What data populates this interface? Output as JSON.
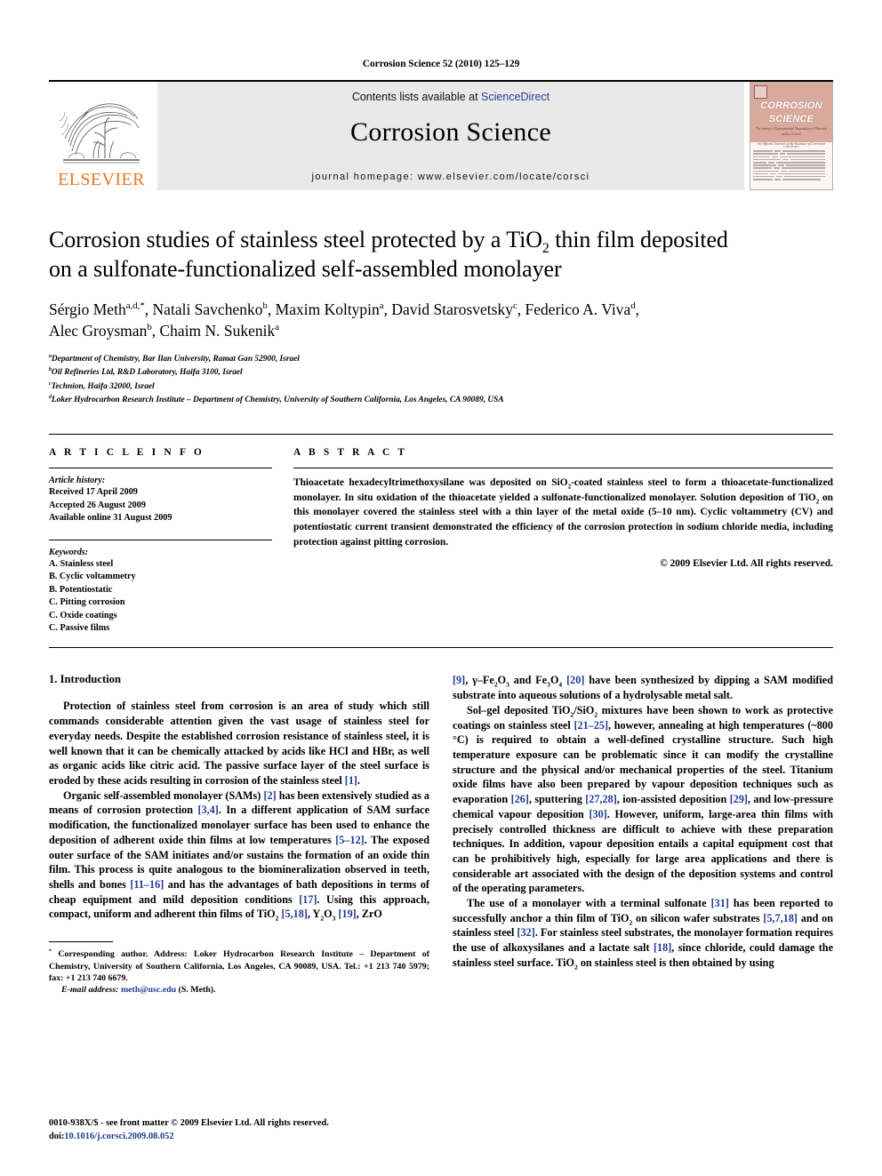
{
  "running_head": "Corrosion Science 52 (2010) 125–129",
  "masthead": {
    "publisher_name": "ELSEVIER",
    "publisher_logo_icon": "elsevier-tree-icon",
    "contents_prefix": "Contents lists available at ",
    "sciencedirect_label": "ScienceDirect",
    "journal_title": "Corrosion Science",
    "homepage_line": "journal homepage: www.elsevier.com/locate/corsci",
    "cover": {
      "title_line1": "CORROSION",
      "title_line2": "SCIENCE",
      "subtitle": "The Journal of Environmental Degradation of Materials and its Control",
      "society_line": "An Official Journal of the Institute of Corrosion",
      "contents_label": "CONTENTS"
    }
  },
  "article": {
    "title_line1_a": "Corrosion studies of stainless steel protected by a TiO",
    "title_line1_sub": "2",
    "title_line1_b": " thin film deposited",
    "title_line2": "on a sulfonate-functionalized self-assembled monolayer",
    "authors": [
      {
        "name": "Sérgio Meth",
        "marks": "a,d,*",
        "sep": ", "
      },
      {
        "name": "Natali Savchenko",
        "marks": "b",
        "sep": ", "
      },
      {
        "name": "Maxim Koltypin",
        "marks": "a",
        "sep": ", "
      },
      {
        "name": "David Starosvetsky",
        "marks": "c",
        "sep": ", "
      },
      {
        "name": "Federico A. Viva",
        "marks": "d",
        "sep": ", "
      },
      {
        "name": "Alec Groysman",
        "marks": "b",
        "sep": ", "
      },
      {
        "name": "Chaim N. Sukenik",
        "marks": "a",
        "sep": ""
      }
    ],
    "affiliations": [
      {
        "mark": "a",
        "text": "Department of Chemistry, Bar Ilan University, Ramat Gan 52900, Israel"
      },
      {
        "mark": "b",
        "text": "Oil Refineries Ltd, R&D Laboratory, Haifa 3100, Israel"
      },
      {
        "mark": "c",
        "text": "Technion, Haifa 32000, Israel"
      },
      {
        "mark": "d",
        "text": "Loker Hydrocarbon Research Institute – Department of Chemistry, University of Southern California, Los Angeles, CA 90089, USA"
      }
    ]
  },
  "article_info": {
    "heading": "A R T I C L E    I N F O",
    "history_label": "Article history:",
    "history": [
      "Received 17 April 2009",
      "Accepted 26 August 2009",
      "Available online 31 August 2009"
    ],
    "keywords_label": "Keywords:",
    "keywords": [
      "A. Stainless steel",
      "B. Cyclic voltammetry",
      "B. Potentiostatic",
      "C. Pitting corrosion",
      "C. Oxide coatings",
      "C. Passive films"
    ]
  },
  "abstract": {
    "heading": "A B S T R A C T",
    "part1": "Thioacetate hexadecyltrimethoxysilane was deposited on SiO",
    "sub1": "2",
    "part2": "-coated stainless steel to form a thioacetate-functionalized monolayer. In situ oxidation of the thioacetate yielded a sulfonate-functionalized monolayer. Solution deposition of TiO",
    "sub2": "2",
    "part3": " on this monolayer covered the stainless steel with a thin layer of the metal oxide (5–10 nm). Cyclic voltammetry (CV) and potentiostatic current transient demonstrated the efficiency of the corrosion protection in sodium chloride media, including protection against pitting corrosion.",
    "copyright": "© 2009 Elsevier Ltd. All rights reserved."
  },
  "body": {
    "section_title": "1. Introduction",
    "left_paragraphs": {
      "p1": "Protection of stainless steel from corrosion is an area of study which still commands considerable attention given the vast usage of stainless steel for everyday needs. Despite the established corrosion resistance of stainless steel, it is well known that it can be chemically attacked by acids like HCl and HBr, as well as organic acids like citric acid. The passive surface layer of the steel surface is eroded by these acids resulting in corrosion of the stainless steel ",
      "p1_ref": "[1]",
      "p1_end": ".",
      "p2_a": "Organic self-assembled monolayer (SAMs) ",
      "p2_r1": "[2]",
      "p2_b": " has been extensively studied as a means of corrosion protection ",
      "p2_r2": "[3,4]",
      "p2_c": ". In a different application of SAM surface modification, the functionalized monolayer surface has been used to enhance the deposition of adherent oxide thin films at low temperatures ",
      "p2_r3": "[5–12]",
      "p2_d": ". The exposed outer surface of the SAM initiates and/or sustains the formation of an oxide thin film. This process is quite analogous to the biomineralization observed in teeth, shells and bones ",
      "p2_r4": "[11–16]",
      "p2_e": " and has the advantages of bath depositions in terms of cheap equipment and mild deposition conditions ",
      "p2_r5": "[17]",
      "p2_f": ". Using this approach, compact, uniform and adherent thin films of TiO",
      "p2_sub1": "2",
      "p2_g": " ",
      "p2_r6": "[5,18]",
      "p2_h": ", Y",
      "p2_sub2": "2",
      "p2_i": "O",
      "p2_sub3": "3",
      "p2_j": " ",
      "p2_r7": "[19]",
      "p2_k": ", ZrO"
    },
    "right_paragraphs": {
      "p3_r1": "[9]",
      "p3_a": ", γ–Fe",
      "p3_s1": "2",
      "p3_b": "O",
      "p3_s2": "3",
      "p3_c": " and Fe",
      "p3_s3": "3",
      "p3_d": "O",
      "p3_s4": "4",
      "p3_e": " ",
      "p3_r2": "[20]",
      "p3_f": " have been synthesized by dipping a SAM modified substrate into aqueous solutions of a hydrolysable metal salt.",
      "p4_a": "Sol–gel deposited TiO",
      "p4_s1": "2",
      "p4_b": "/SiO",
      "p4_s2": "2",
      "p4_c": " mixtures have been shown to work as protective coatings on stainless steel ",
      "p4_r1": "[21–25]",
      "p4_d": ", however, annealing at high temperatures (~800 °C) is required to obtain a well-defined crystalline structure. Such high temperature exposure can be problematic since it can modify the crystalline structure and the physical and/or mechanical properties of the steel. Titanium oxide films have also been prepared by vapour deposition techniques such as evaporation ",
      "p4_r2": "[26]",
      "p4_e": ", sputtering ",
      "p4_r3": "[27,28]",
      "p4_f": ", ion-assisted deposition ",
      "p4_r4": "[29]",
      "p4_g": ", and low-pressure chemical vapour deposition ",
      "p4_r5": "[30]",
      "p4_h": ". However, uniform, large-area thin films with precisely controlled thickness are difficult to achieve with these preparation techniques. In addition, vapour deposition entails a capital equipment cost that can be prohibitively high, especially for large area applications and there is considerable art associated with the design of the deposition systems and control of the operating parameters.",
      "p5_a": "The use of a monolayer with a terminal sulfonate ",
      "p5_r1": "[31]",
      "p5_b": " has been reported to successfully anchor a thin film of TiO",
      "p5_s1": "2",
      "p5_c": " on silicon wafer substrates ",
      "p5_r2": "[5,7,18]",
      "p5_d": " and on stainless steel ",
      "p5_r3": "[32]",
      "p5_e": ". For stainless steel substrates, the monolayer formation requires the use of alkoxysilanes and a lactate salt ",
      "p5_r4": "[18]",
      "p5_f": ", since chloride, could damage the stainless steel surface. TiO",
      "p5_s2": "2",
      "p5_g": " on stainless steel is then obtained by using"
    }
  },
  "footnote": {
    "marker": "*",
    "text": " Corresponding author. Address: Loker Hydrocarbon Research Institute – Department of Chemistry, University of Southern California, Los Angeles, CA 90089, USA. Tel.: +1 213 740 5979; fax: +1 213 740 6679.",
    "email_label": "E-mail address:",
    "email": "meth@usc.edu",
    "email_author": " (S. Meth)."
  },
  "page_footer": {
    "issn_line": "0010-938X/$ - see front matter © 2009 Elsevier Ltd. All rights reserved.",
    "doi_label": "doi:",
    "doi_value": "10.1016/j.corsci.2009.08.052"
  },
  "colors": {
    "link_blue": "#1f3a93",
    "sciencedirect_blue": "#2b3c8f",
    "elsevier_orange": "#E87722",
    "masthead_gray": "#e9e9e9",
    "cover_salmon": "#d9a99d"
  }
}
